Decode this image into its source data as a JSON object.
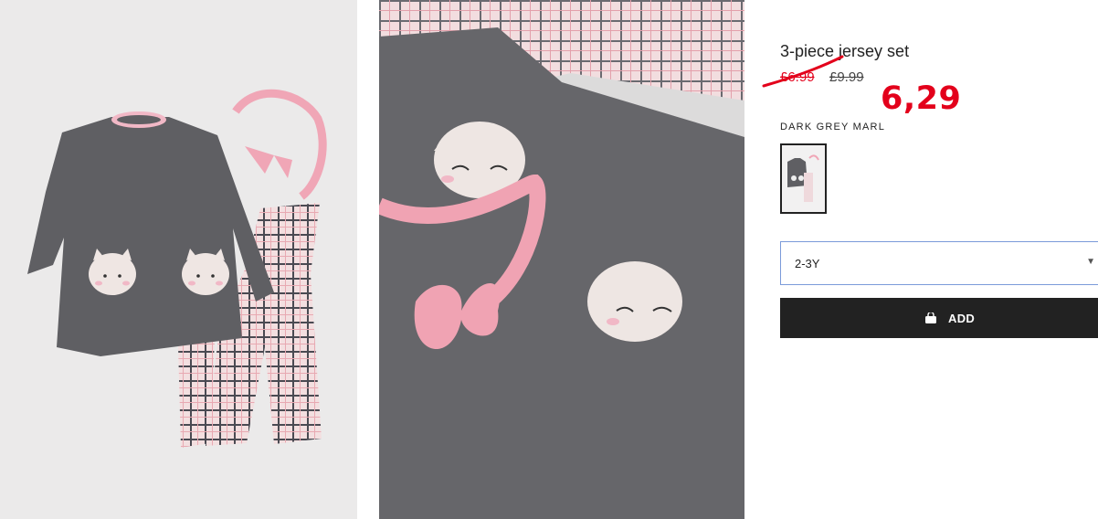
{
  "gallery": {
    "image1_alt": "",
    "image2_alt": ""
  },
  "product": {
    "title": "3-piece jersey set",
    "price_struck_red": "£6.99",
    "price_original": "£9.99",
    "price_new": "6,29",
    "color_label": "DARK GREY MARL"
  },
  "size_select": {
    "value": "2-3Y"
  },
  "add_button": {
    "label": "ADD",
    "icon": "shopping-bag-icon"
  },
  "colors": {
    "accent_red": "#e3001b",
    "button_bg": "#222222",
    "select_border": "#7b9bd9"
  }
}
